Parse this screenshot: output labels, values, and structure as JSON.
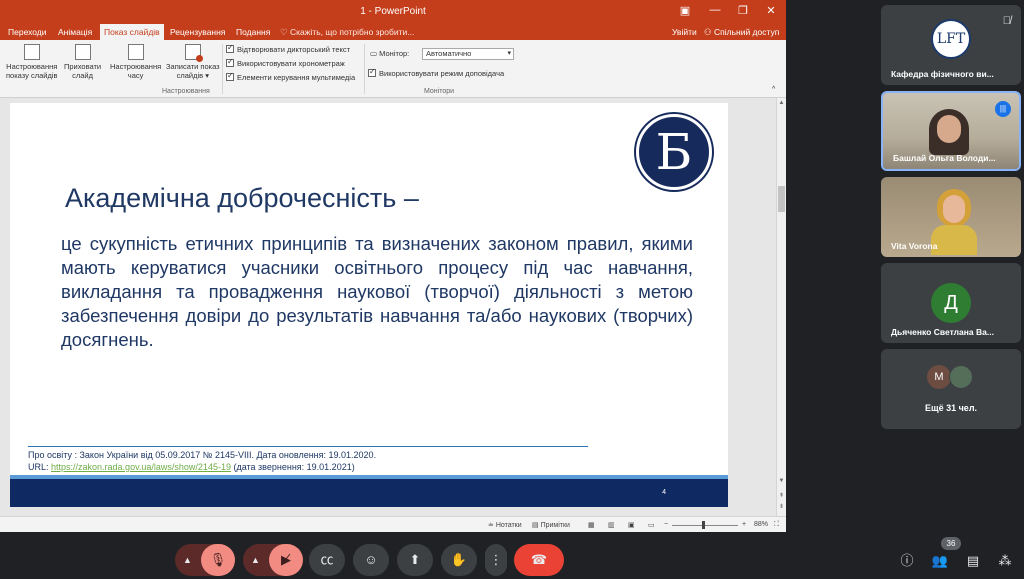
{
  "ppt": {
    "window_title": "1 - PowerPoint",
    "window_controls": [
      "▣",
      "—",
      "❐",
      "✕"
    ],
    "tabs": [
      "Переходи",
      "Анімація",
      "Показ слайдів",
      "Рецензування",
      "Подання"
    ],
    "active_tab": "Показ слайдів",
    "tell_me": "♡ Скажіть, що потрібно зробити...",
    "sign_in": "Увійти",
    "share": "Спільний доступ",
    "ribbon": {
      "btn_setup": "Настроювання\nпоказу слайдів",
      "btn_hide": "Приховати\nслайд",
      "btn_rehearse": "Настроювання\nчасу",
      "btn_record": "Записати показ\nслайдів ▾",
      "chk_narration": "Відтворювати дикторський текст",
      "chk_timings": "Використовувати хронометраж",
      "chk_media": "Елементи керування мультимедіа",
      "group_setup": "Настроювання",
      "monitor_label": "Монітор:",
      "monitor_value": "Автоматично",
      "chk_presenter": "Використовувати режим доповідача",
      "group_monitors": "Монітори"
    },
    "slide": {
      "logo_letter": "Б",
      "title": "Академічна доброчесність –",
      "body": "це сукупність етичних принципів та визначених законом правил, якими мають керуватися учасники освітнього процесу під час навчання, викладання та провадження наукової (творчої) діяльності з метою забезпечення довіри до результатів навчання та/або наукових (творчих) досягнень.",
      "source_line1": "Про освіту : Закон України від 05.09.2017 № 2145-VIII. Дата оновлення: 19.01.2020.",
      "source_url_prefix": "URL: ",
      "source_url": "https://zakon.rada.gov.ua/laws/show/2145-19",
      "source_url_suffix": " (дата звернення: 19.01.2021)",
      "page_number": "4"
    },
    "status": {
      "notes": "Нотатки",
      "comments": "Примітки",
      "zoom_minus": "−",
      "zoom_plus": "+",
      "zoom": "88%"
    }
  },
  "participants": [
    {
      "name": "Кафедра фізичного ви...",
      "muted": true,
      "logo_text": "LFT"
    },
    {
      "name": "Башлай Ольга Володи...",
      "speaking": true
    },
    {
      "name": "Vita Vorona"
    },
    {
      "name": "Дьяченко Светлана Ва...",
      "initial": "Д",
      "avatar_color": "#2e7d32"
    },
    {
      "more_label": "Ещё 31 чел.",
      "initial": "М"
    }
  ],
  "controls": {
    "mic_icon": "mic-off",
    "cam_icon": "camera-off",
    "participant_count": "36"
  }
}
